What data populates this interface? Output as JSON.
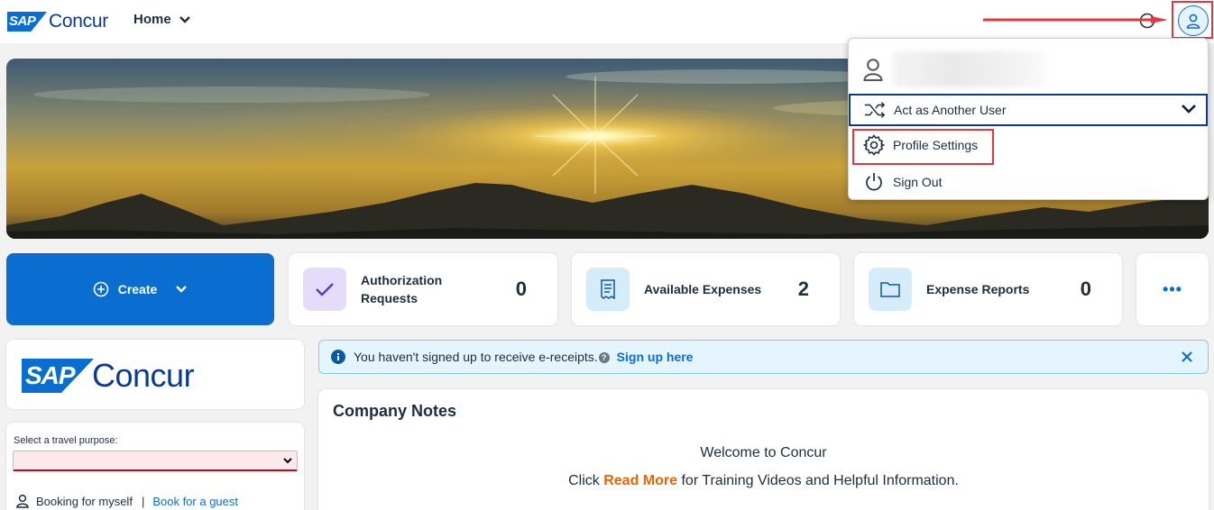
{
  "header": {
    "logo_sap": "SAP",
    "logo_word": "Concur",
    "nav_home": "Home"
  },
  "cards": {
    "create_label": "Create",
    "authorization": {
      "label": "Authorization Requests",
      "value": "0"
    },
    "available_expenses": {
      "label": "Available Expenses",
      "value": "2"
    },
    "expense_reports": {
      "label": "Expense Reports",
      "value": "0"
    },
    "more_label": "•••"
  },
  "brand": {
    "sap": "SAP",
    "word": "Concur"
  },
  "travel": {
    "purpose_label": "Select a travel purpose:",
    "booking_myself": "Booking for myself",
    "separator": "|",
    "booking_guest": "Book for a guest"
  },
  "info_bar": {
    "message": "You haven't signed up to receive e-receipts.",
    "help_glyph": "?",
    "link": "Sign up here"
  },
  "company_notes": {
    "title": "Company Notes",
    "welcome": "Welcome to Concur",
    "line_prefix": "Click",
    "read_more": "Read More",
    "line_suffix": "for Training Videos and Helpful Information."
  },
  "user_menu": {
    "act_as_another_user": "Act as Another User",
    "profile_settings": "Profile Settings",
    "sign_out": "Sign Out"
  },
  "colors": {
    "accent": "#0a6ed1",
    "highlight_frame": "#e0383e",
    "read_more": "#e76500",
    "info_bg": "#e5f5fd"
  }
}
